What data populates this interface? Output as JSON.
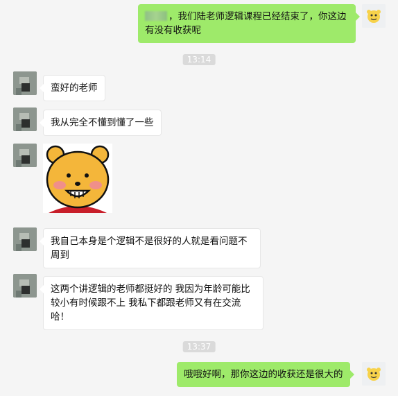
{
  "messages": [
    {
      "side": "right",
      "text": "，我们陆老师逻辑课程已经结束了，你这边有没有收获呢",
      "redacted_prefix": true
    },
    {
      "type": "time",
      "text": "13:14"
    },
    {
      "side": "left",
      "text": "蛮好的老师"
    },
    {
      "side": "left",
      "text": "我从完全不懂到懂了一些"
    },
    {
      "side": "left",
      "type": "sticker",
      "sticker": "pooh-sticker"
    },
    {
      "side": "left",
      "text": "我自己本身是个逻辑不是很好的人就是看问题不周到"
    },
    {
      "side": "left",
      "text": "这两个讲逻辑的老师都挺好的 我因为年龄可能比较小有时候跟不上 我私下都跟老师又有在交流哈！"
    },
    {
      "type": "time",
      "text": "13:37"
    },
    {
      "side": "right",
      "text": "哦哦好啊，那你这边的收获还是很大的"
    }
  ],
  "colors": {
    "background": "#f5f5f5",
    "bubble_self": "#9eea6a",
    "bubble_other": "#ffffff",
    "time_badge": "#dadada"
  }
}
